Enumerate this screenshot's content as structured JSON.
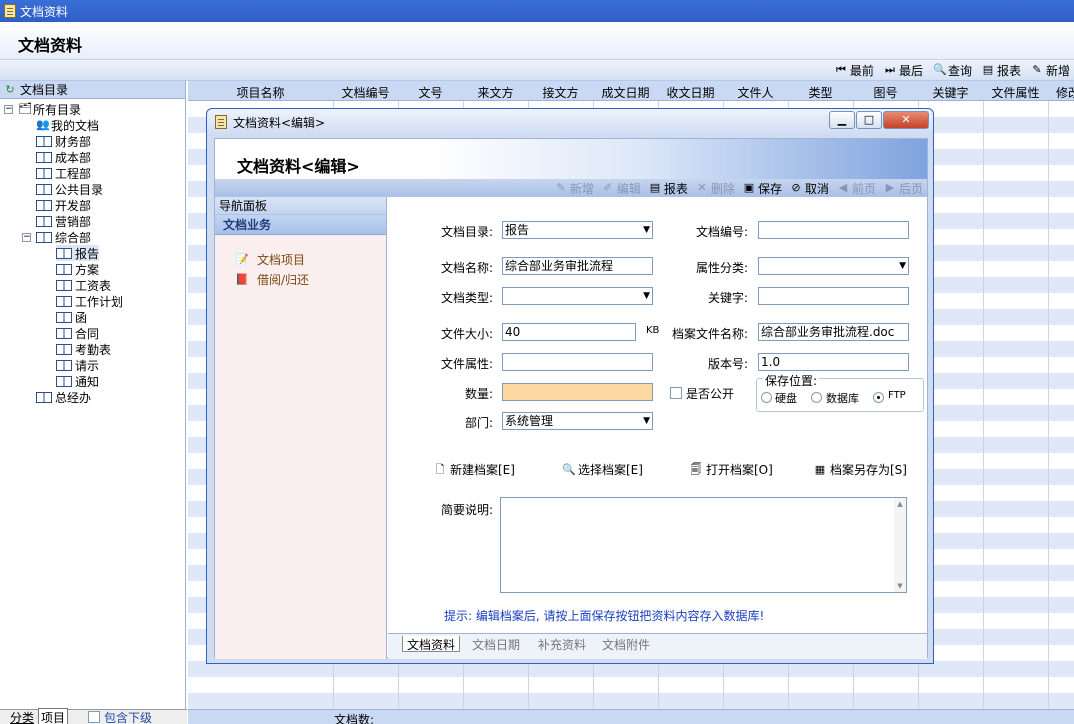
{
  "window_title": "文档资料",
  "page_title": "文档资料",
  "toolbar": {
    "first": "最前",
    "last": "最后",
    "search": "查询",
    "report": "报表",
    "add": "新增"
  },
  "tree": {
    "header": "文档目录",
    "root": "所有目录",
    "items": [
      "我的文档",
      "财务部",
      "成本部",
      "工程部",
      "公共目录",
      "开发部",
      "营销部",
      "综合部"
    ],
    "sub": [
      "报告",
      "方案",
      "工资表",
      "工作计划",
      "函",
      "合同",
      "考勤表",
      "请示",
      "通知"
    ],
    "last": "总经办"
  },
  "left_bottom": {
    "tab_category": "分类",
    "tab_project": "项目",
    "include_sub": "包含下级"
  },
  "columns": [
    "项目名称",
    "文档编号",
    "文号",
    "来文方",
    "接文方",
    "成文日期",
    "收文日期",
    "文件人",
    "类型",
    "图号",
    "关键字",
    "文件属性",
    "修改"
  ],
  "grid_footer": {
    "doc_count_label": "文档数:"
  },
  "dialog": {
    "title": "文档资料<编辑>",
    "heading": "文档资料<编辑>",
    "toolbar": {
      "add": "新增",
      "edit": "编辑",
      "report": "报表",
      "delete": "删除",
      "save": "保存",
      "cancel": "取消",
      "prev": "前页",
      "next": "后页"
    },
    "nav": {
      "panel": "导航面板",
      "section": "文档业务",
      "items": [
        "文档项目",
        "借阅/归还"
      ]
    },
    "form": {
      "catalog_label": "文档目录:",
      "catalog_value": "报告",
      "code_label": "文档编号:",
      "code_value": "",
      "name_label": "文档名称:",
      "name_value": "综合部业务审批流程",
      "attr_cat_label": "属性分类:",
      "attr_cat_value": "",
      "type_label": "文档类型:",
      "type_value": "",
      "keyword_label": "关键字:",
      "keyword_value": "",
      "size_label": "文件大小:",
      "size_value": "40",
      "size_unit": "KB",
      "file_name_label": "档案文件名称:",
      "file_name_value": "综合部业务审批流程.doc",
      "file_attr_label": "文件属性:",
      "file_attr_value": "",
      "version_label": "版本号:",
      "version_value": "1.0",
      "qty_label": "数量:",
      "qty_value": "",
      "public_label": "是否公开",
      "storage_label": "保存位置:",
      "storage_disk": "硬盘",
      "storage_db": "数据库",
      "storage_ftp": "FTP",
      "dept_label": "部门:",
      "dept_value": "系统管理",
      "btn_new": "新建档案[E]",
      "btn_select": "选择档案[E]",
      "btn_open": "打开档案[O]",
      "btn_saveas": "档案另存为[S]",
      "desc_label": "简要说明:",
      "hint": "提示: 编辑档案后, 请按上面保存按钮把资料内容存入数据库!"
    },
    "tabs": [
      "文档资料",
      "文档日期",
      "补充资料",
      "文档附件"
    ]
  }
}
